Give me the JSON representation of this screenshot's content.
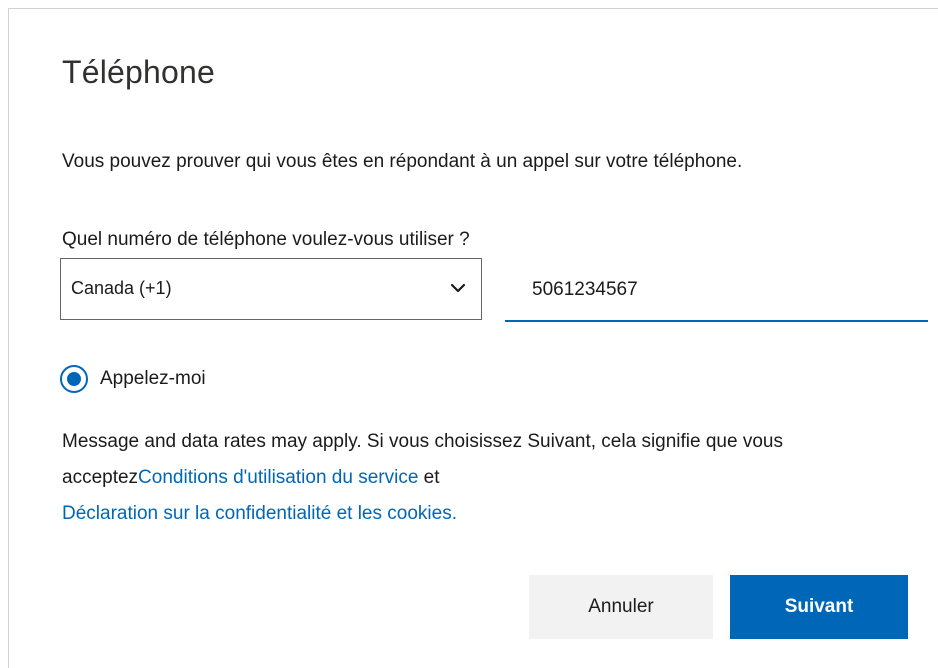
{
  "dialog": {
    "title": "Téléphone",
    "description": "Vous pouvez prouver qui vous êtes en répondant à un appel sur votre téléphone.",
    "question": "Quel numéro de téléphone voulez-vous utiliser ?"
  },
  "country_select": {
    "selected": "Canada (+1)"
  },
  "phone_input": {
    "value": "5061234567"
  },
  "method": {
    "label": "Appelez-moi",
    "selected": true
  },
  "notice": {
    "text_before": "Message and data rates may apply. Si vous choisissez Suivant, cela signifie que vous acceptez",
    "terms_link": "Conditions d'utilisation du service",
    "conjunction": " et ",
    "privacy_link": "Déclaration sur la confidentialité et les cookies."
  },
  "buttons": {
    "cancel_label": "Annuler",
    "next_label": "Suivant"
  },
  "colors": {
    "accent": "#0067b8",
    "cancel_bg": "#f2f2f2"
  },
  "icons": {
    "select_chevron": "chevron-down-icon",
    "radio": "radio-selected-icon"
  }
}
